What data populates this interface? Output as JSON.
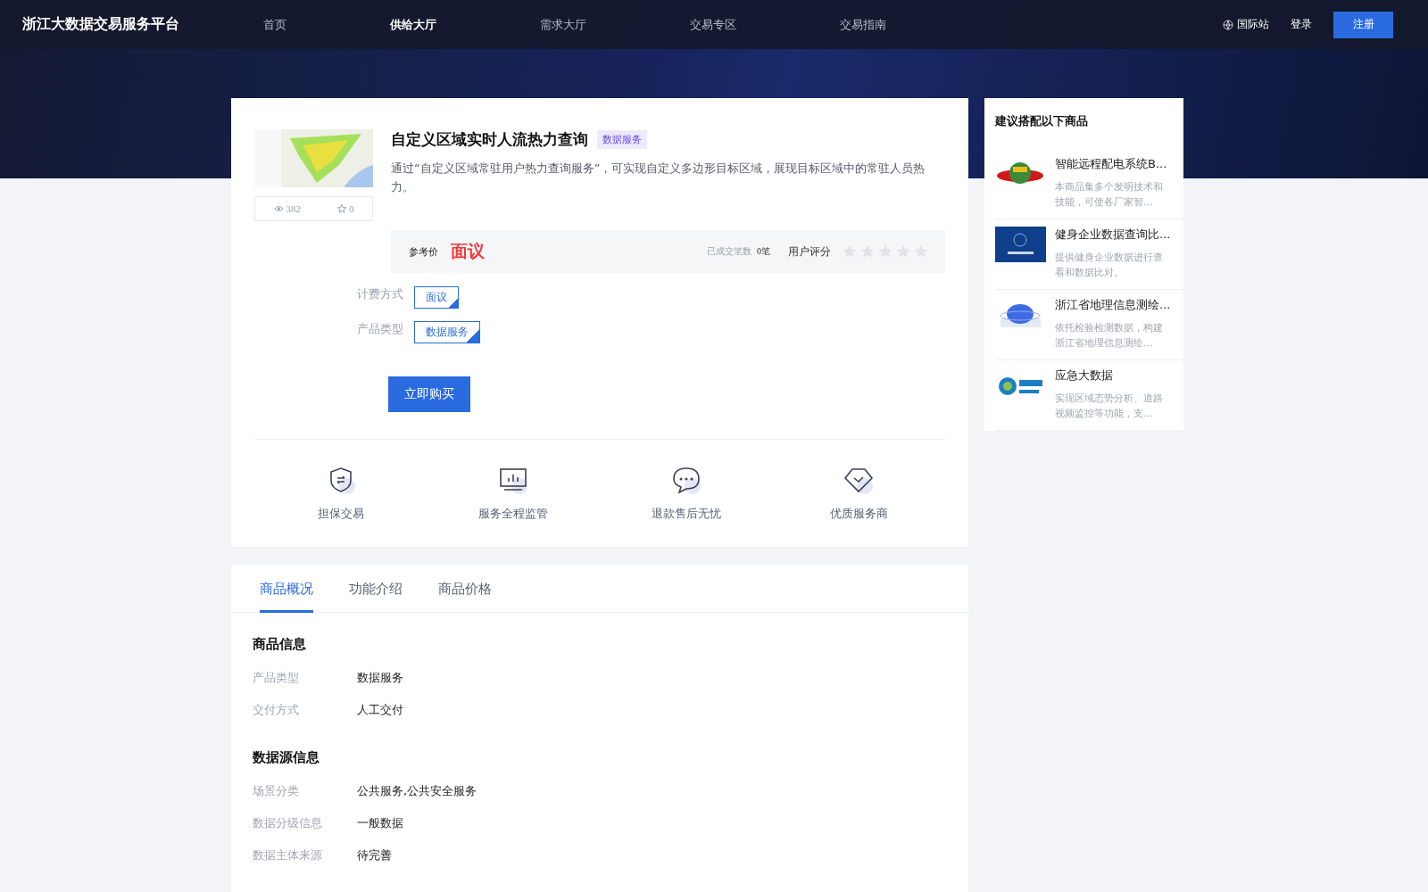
{
  "header": {
    "logo": "浙江大数据交易服务平台",
    "nav": [
      {
        "label": "首页",
        "selected": false
      },
      {
        "label": "供给大厅",
        "selected": true
      },
      {
        "label": "需求大厅",
        "selected": false
      },
      {
        "label": "交易专区",
        "selected": false
      },
      {
        "label": "交易指南",
        "selected": false
      }
    ],
    "international": "国际站",
    "login": "登录",
    "register": "注册"
  },
  "product": {
    "title": "自定义区域实时人流热力查询",
    "tag": "数据服务",
    "description": "通过“自定义区域常驻用户热力查询服务”，可实现自定义多边形目标区域，展现目标区域中的常驻人员热力。",
    "views": "382",
    "favorites": "0",
    "price_label": "参考价",
    "price": "面议",
    "deals_label": "已成交笔数",
    "deals": "0笔",
    "rating_label": "用户评分",
    "stars": 0,
    "options": [
      {
        "label": "计费方式",
        "value": "面议"
      },
      {
        "label": "产品类型",
        "value": "数据服务"
      }
    ],
    "buy": "立即购买",
    "features": [
      {
        "kind": "shield",
        "label": "担保交易"
      },
      {
        "kind": "monitor",
        "label": "服务全程监管"
      },
      {
        "kind": "chat",
        "label": "退款售后无忧"
      },
      {
        "kind": "diamond",
        "label": "优质服务商"
      }
    ]
  },
  "tabs": [
    {
      "label": "商品概况",
      "selected": true
    },
    {
      "label": "功能介绍",
      "selected": false
    },
    {
      "label": "商品价格",
      "selected": false
    }
  ],
  "sections": [
    {
      "title": "商品信息",
      "rows": [
        {
          "label": "产品类型",
          "value": "数据服务"
        },
        {
          "label": "交付方式",
          "value": "人工交付"
        }
      ]
    },
    {
      "title": "数据源信息",
      "rows": [
        {
          "label": "场景分类",
          "value": "公共服务,公共安全服务"
        },
        {
          "label": "数据分级信息",
          "value": "一般数据"
        },
        {
          "label": "数据主体来源",
          "value": "待完善"
        }
      ]
    }
  ],
  "suggestions": {
    "title": "建议搭配以下商品",
    "items": [
      {
        "kind": "picture",
        "name": "智能远程配电系统B...",
        "description": "本商品集多个发明技术和技能，可使各厂家智..."
      },
      {
        "kind": "picture",
        "name": "健身企业数据查询比...",
        "description": "提供健身企业数据进行查看和数据比对。"
      },
      {
        "kind": "picture",
        "name": "浙江省地理信息测绘...",
        "description": "依托检验检测数据，构建浙江省地理信息测绘..."
      },
      {
        "kind": "picture",
        "name": "应急大数据",
        "description": "实现区域态势分析、道路视频监控等功能，支..."
      }
    ]
  }
}
